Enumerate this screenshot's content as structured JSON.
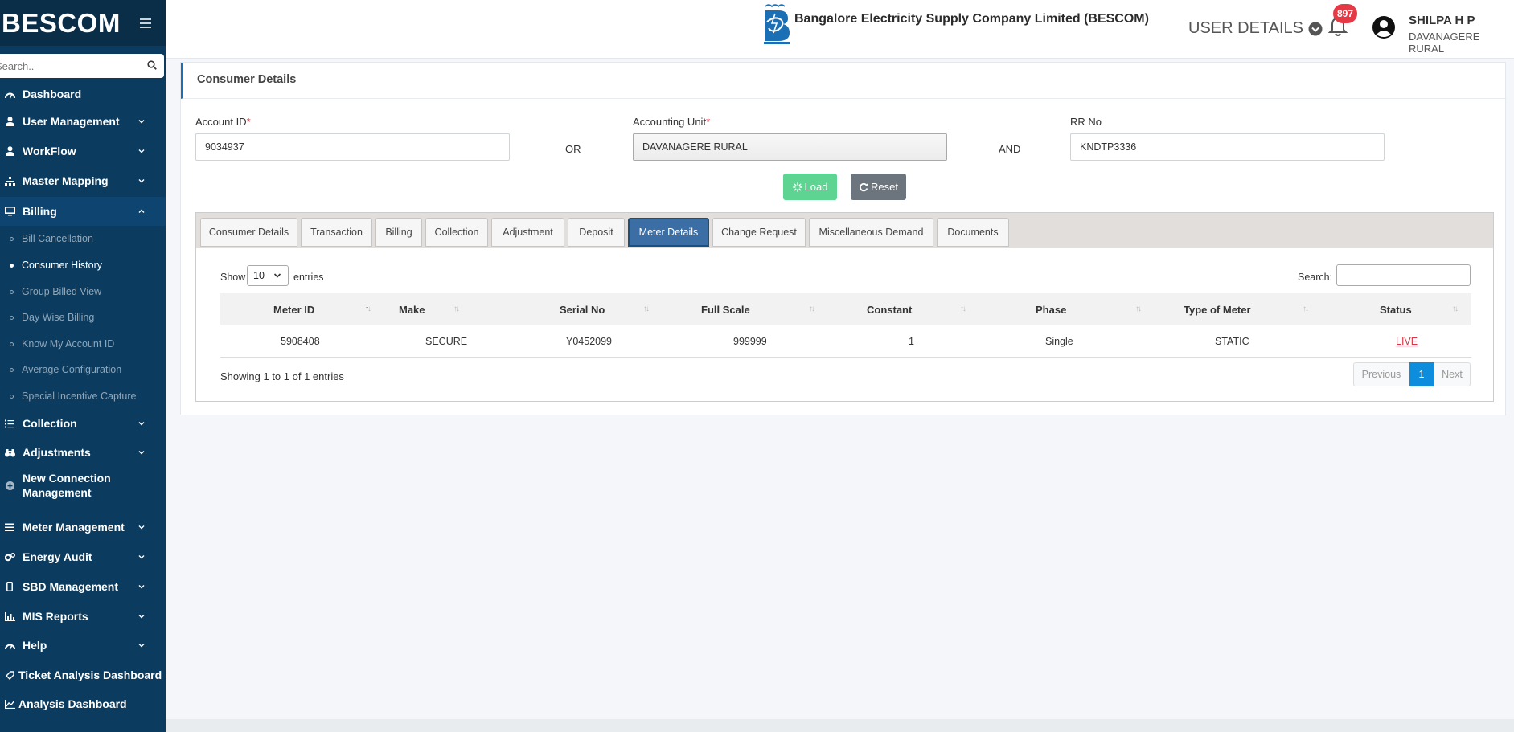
{
  "sidebar": {
    "brand": "BESCOM",
    "search_placeholder": "Search..",
    "items": [
      {
        "label": "Dashboard",
        "icon": "dashboard-icon"
      },
      {
        "label": "User Management",
        "icon": "user-icon"
      },
      {
        "label": "WorkFlow",
        "icon": "user-icon"
      },
      {
        "label": "Master Mapping",
        "icon": "sitemap-icon"
      },
      {
        "label": "Billing",
        "icon": "monitor-icon"
      },
      {
        "label": "Collection",
        "icon": "list-icon"
      },
      {
        "label": "Adjustments",
        "icon": "binoculars-icon"
      },
      {
        "label": "New Connection Management",
        "icon": "plus-circle-icon"
      },
      {
        "label": "Meter Management",
        "icon": "list-icon"
      },
      {
        "label": "Energy Audit",
        "icon": "gears-icon"
      },
      {
        "label": "SBD Management",
        "icon": "mobile-icon"
      },
      {
        "label": "MIS Reports",
        "icon": "bar-chart-icon"
      },
      {
        "label": "Help",
        "icon": "dashboard-icon"
      },
      {
        "label": "Ticket Analysis Dashboard",
        "icon": "tag-icon"
      },
      {
        "label": "Analysis Dashboard",
        "icon": "line-chart-icon"
      }
    ],
    "billing_sub": [
      "Bill Cancellation",
      "Consumer History",
      "Group Billed View",
      "Day Wise Billing",
      "Know My Account ID",
      "Average Configuration",
      "Special Incentive Capture"
    ]
  },
  "header": {
    "company": "Bangalore Electricity Supply Company Limited (BESCOM)",
    "user_details_label": "USER DETAILS",
    "notification_count": "897",
    "user_name": "SHILPA H P",
    "user_location": "DAVANAGERE RURAL"
  },
  "form": {
    "title": "Consumer Details",
    "account_id_label": "Account ID",
    "account_id_value": "9034937",
    "or_label": "OR",
    "accounting_unit_label": "Accounting Unit",
    "accounting_unit_value": "DAVANAGERE RURAL",
    "and_label": "AND",
    "rr_no_label": "RR No",
    "rr_no_value": "KNDTP3336",
    "required_mark": "*",
    "load_label": "Load",
    "reset_label": "Reset"
  },
  "tabs": [
    "Consumer Details",
    "Transaction",
    "Billing",
    "Collection",
    "Adjustment",
    "Deposit",
    "Meter Details",
    "Change Request",
    "Miscellaneous Demand",
    "Documents"
  ],
  "active_tab": "Meter Details",
  "table": {
    "show_label": "Show",
    "page_length": "10",
    "entries_label": "entries",
    "search_label": "Search:",
    "columns": [
      "Meter ID",
      "Make",
      "Serial No",
      "Full Scale",
      "Constant",
      "Phase",
      "Type of Meter",
      "Status"
    ],
    "rows": [
      [
        "5908408",
        "SECURE",
        "Y0452099",
        "999999",
        "1",
        "Single",
        "STATIC",
        "LIVE"
      ]
    ],
    "info": "Showing 1 to 1 of 1 entries",
    "prev_label": "Previous",
    "page": "1",
    "next_label": "Next"
  },
  "colors": {
    "sidebar_bg": "#0b3b5e",
    "accent": "#1b6fb5",
    "active_tab": "#3a6ea5",
    "load_button": "#5dd491",
    "reset_button": "#6c757d",
    "live_status": "#dc3545"
  }
}
